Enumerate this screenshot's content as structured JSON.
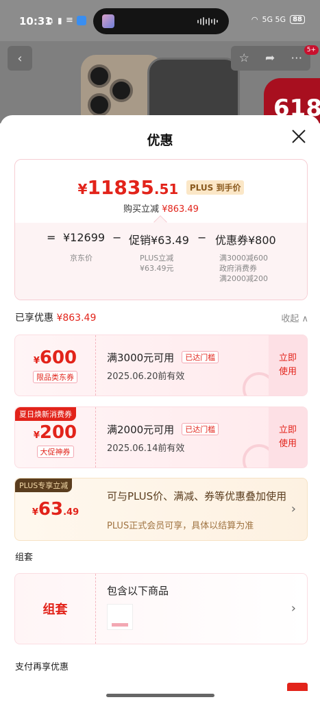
{
  "status_bar": {
    "time": "10:31",
    "network": "5G 5G",
    "battery": "88"
  },
  "background": {
    "badge": "5+",
    "promo": "618"
  },
  "sheet": {
    "title": "优惠",
    "price": {
      "yen": "¥",
      "integer": "11835",
      "decimal": ".51",
      "tag": "PLUS 到手价",
      "saving_label": "购买立减",
      "saving_amount": "¥863.49"
    },
    "formula": {
      "eq": "=",
      "base": "¥12699",
      "minus1": "−",
      "promo": "促销¥63.49",
      "minus2": "−",
      "coupon": "优惠券¥800",
      "base_label": "京东价",
      "promo_label_1": "PLUS立减",
      "promo_label_2": "¥63.49元",
      "coupon_label_1": "满3000减600",
      "coupon_label_2": "政府消费券",
      "coupon_label_3": "满2000减200"
    },
    "enjoyed": {
      "label": "已享优惠",
      "amount": "¥863.49",
      "collapse": "收起"
    },
    "coupons": [
      {
        "yen": "¥",
        "amount": "600",
        "kind": "限品类东券",
        "condition": "满3000元可用",
        "reached": "已达门槛",
        "valid": "2025.06.20前有效",
        "use_1": "立即",
        "use_2": "使用"
      },
      {
        "tag": "夏日焕新消费券",
        "yen": "¥",
        "amount": "200",
        "kind": "大促神券",
        "condition": "满2000元可用",
        "reached": "已达门槛",
        "valid": "2025.06.14前有效",
        "use_1": "立即",
        "use_2": "使用"
      }
    ],
    "plus": {
      "tag": "PLUS专享立减",
      "yen": "¥",
      "amount": "63",
      "decimal": ".49",
      "text": "可与PLUS价、满减、券等优惠叠加使用",
      "sub": "PLUS正式会员可享，具体以结算为准"
    },
    "bundle": {
      "section": "组套",
      "label": "组套",
      "title": "包含以下商品"
    },
    "pay_section": "支付再享优惠"
  },
  "colors": {
    "accent_red": "#e2231a",
    "plus_brown": "#5a3d1e"
  }
}
